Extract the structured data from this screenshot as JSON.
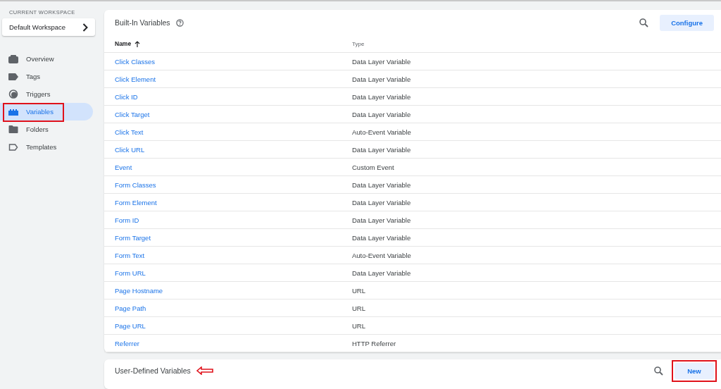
{
  "sidebar": {
    "workspace_label": "CURRENT WORKSPACE",
    "workspace": "Default Workspace",
    "items": [
      {
        "label": "Overview",
        "kind": "overview",
        "selected": false,
        "highlighted": false
      },
      {
        "label": "Tags",
        "kind": "tag",
        "selected": false,
        "highlighted": false
      },
      {
        "label": "Triggers",
        "kind": "trigger",
        "selected": false,
        "highlighted": false
      },
      {
        "label": "Variables",
        "kind": "variable",
        "selected": true,
        "highlighted": true
      },
      {
        "label": "Folders",
        "kind": "folder",
        "selected": false,
        "highlighted": false
      },
      {
        "label": "Templates",
        "kind": "template",
        "selected": false,
        "highlighted": false
      }
    ]
  },
  "builtin": {
    "title": "Built-In Variables",
    "button": {
      "label": "Configure"
    },
    "columns": [
      "Name",
      "Type"
    ],
    "rows": [
      {
        "name": "Click Classes",
        "type": "Data Layer Variable"
      },
      {
        "name": "Click Element",
        "type": "Data Layer Variable"
      },
      {
        "name": "Click ID",
        "type": "Data Layer Variable"
      },
      {
        "name": "Click Target",
        "type": "Data Layer Variable"
      },
      {
        "name": "Click Text",
        "type": "Auto-Event Variable"
      },
      {
        "name": "Click URL",
        "type": "Data Layer Variable"
      },
      {
        "name": "Event",
        "type": "Custom Event"
      },
      {
        "name": "Form Classes",
        "type": "Data Layer Variable"
      },
      {
        "name": "Form Element",
        "type": "Data Layer Variable"
      },
      {
        "name": "Form ID",
        "type": "Data Layer Variable"
      },
      {
        "name": "Form Target",
        "type": "Data Layer Variable"
      },
      {
        "name": "Form Text",
        "type": "Auto-Event Variable"
      },
      {
        "name": "Form URL",
        "type": "Data Layer Variable"
      },
      {
        "name": "Page Hostname",
        "type": "URL"
      },
      {
        "name": "Page Path",
        "type": "URL"
      },
      {
        "name": "Page URL",
        "type": "URL"
      },
      {
        "name": "Referrer",
        "type": "HTTP Referrer"
      }
    ]
  },
  "user_defined": {
    "title": "User-Defined Variables",
    "arrow_annotation": true,
    "button": {
      "label": "New",
      "highlighted": true
    }
  }
}
